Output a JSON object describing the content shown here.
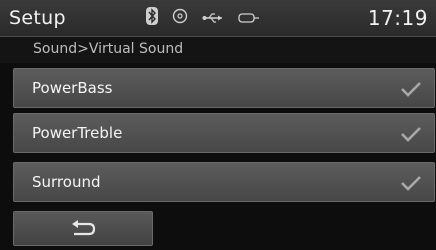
{
  "header": {
    "title": "Setup",
    "clock": "17:19",
    "status_icons": [
      "bluetooth-icon",
      "disc-icon",
      "usb-icon",
      "aux-icon"
    ]
  },
  "breadcrumb": "Sound>Virtual Sound",
  "options": [
    {
      "label": "PowerBass",
      "checked": true
    },
    {
      "label": "PowerTreble",
      "checked": true
    },
    {
      "label": "Surround",
      "checked": true
    }
  ],
  "back_button": {
    "icon": "return-arrow-icon"
  },
  "colors": {
    "background": "#0d0d0d",
    "row": "#555555",
    "check": "#9a9a9a"
  }
}
